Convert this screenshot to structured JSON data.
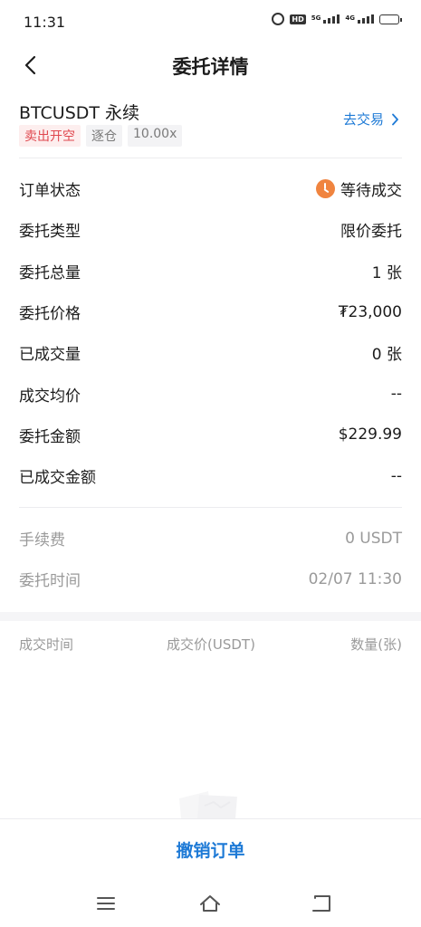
{
  "status_bar": {
    "time": "11:31",
    "hd_label": "HD",
    "signal1_label": "5G",
    "signal2_label": "4G"
  },
  "header": {
    "title": "委托详情"
  },
  "contract": {
    "name": "BTCUSDT 永续",
    "tags": [
      "卖出开空",
      "逐仓",
      "10.00x"
    ],
    "go_trade_label": "去交易"
  },
  "details": [
    {
      "label": "订单状态",
      "value": "等待成交",
      "icon": "clock-icon"
    },
    {
      "label": "委托类型",
      "value": "限价委托"
    },
    {
      "label": "委托总量",
      "value": "1 张"
    },
    {
      "label": "委托价格",
      "value": "₮23,000"
    },
    {
      "label": "已成交量",
      "value": "0 张"
    },
    {
      "label": "成交均价",
      "value": "--"
    },
    {
      "label": "委托金额",
      "value": "$229.99"
    },
    {
      "label": "已成交金额",
      "value": "--"
    }
  ],
  "fees": [
    {
      "label": "手续费",
      "value": "0 USDT"
    },
    {
      "label": "委托时间",
      "value": "02/07 11:30"
    }
  ],
  "trade_table": {
    "columns": [
      "成交时间",
      "成交价(USDT)",
      "数量(张)"
    ]
  },
  "actions": {
    "cancel_label": "撤销订单"
  },
  "colors": {
    "accent": "#1e7ad6",
    "sell": "#e0484f",
    "pending": "#f0843f"
  }
}
